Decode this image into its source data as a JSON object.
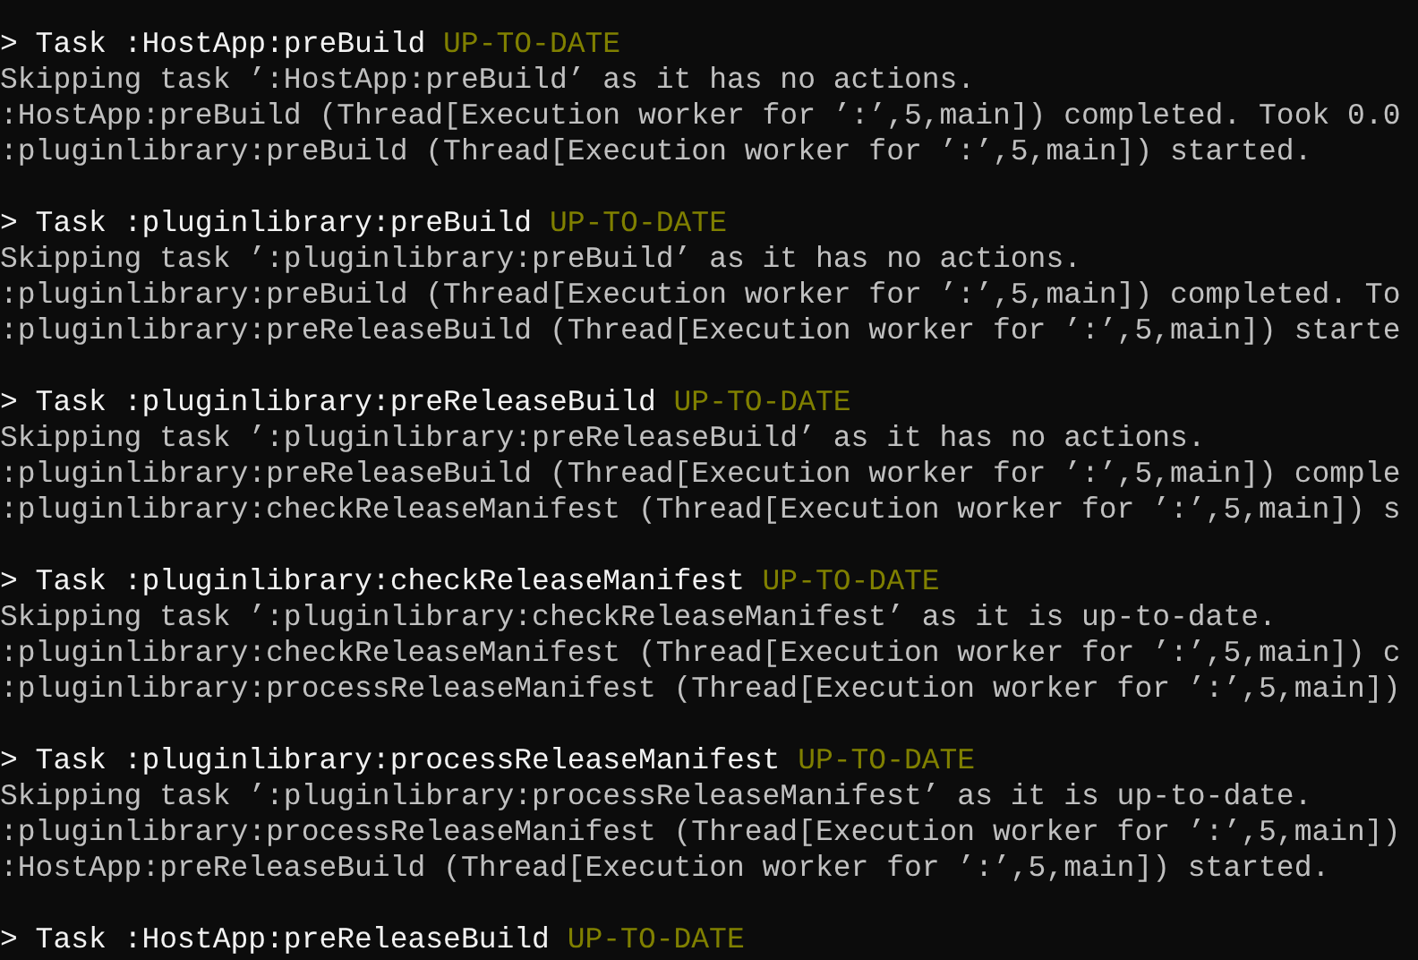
{
  "console": {
    "groups": [
      {
        "title": "> Task :HostApp:preBuild",
        "status": "UP-TO-DATE",
        "lines": [
          "Skipping task ’:HostApp:preBuild’ as it has no actions.",
          ":HostApp:preBuild (Thread[Execution worker for ’:’,5,main]) completed. Took 0.0",
          ":pluginlibrary:preBuild (Thread[Execution worker for ’:’,5,main]) started."
        ]
      },
      {
        "title": "> Task :pluginlibrary:preBuild",
        "status": "UP-TO-DATE",
        "lines": [
          "Skipping task ’:pluginlibrary:preBuild’ as it has no actions.",
          ":pluginlibrary:preBuild (Thread[Execution worker for ’:’,5,main]) completed. To",
          ":pluginlibrary:preReleaseBuild (Thread[Execution worker for ’:’,5,main]) starte"
        ]
      },
      {
        "title": "> Task :pluginlibrary:preReleaseBuild",
        "status": "UP-TO-DATE",
        "lines": [
          "Skipping task ’:pluginlibrary:preReleaseBuild’ as it has no actions.",
          ":pluginlibrary:preReleaseBuild (Thread[Execution worker for ’:’,5,main]) comple",
          ":pluginlibrary:checkReleaseManifest (Thread[Execution worker for ’:’,5,main]) s"
        ]
      },
      {
        "title": "> Task :pluginlibrary:checkReleaseManifest",
        "status": "UP-TO-DATE",
        "lines": [
          "Skipping task ’:pluginlibrary:checkReleaseManifest’ as it is up-to-date.",
          ":pluginlibrary:checkReleaseManifest (Thread[Execution worker for ’:’,5,main]) c",
          ":pluginlibrary:processReleaseManifest (Thread[Execution worker for ’:’,5,main])"
        ]
      },
      {
        "title": "> Task :pluginlibrary:processReleaseManifest",
        "status": "UP-TO-DATE",
        "lines": [
          "Skipping task ’:pluginlibrary:processReleaseManifest’ as it is up-to-date.",
          ":pluginlibrary:processReleaseManifest (Thread[Execution worker for ’:’,5,main])",
          ":HostApp:preReleaseBuild (Thread[Execution worker for ’:’,5,main]) started."
        ]
      },
      {
        "title": "> Task :HostApp:preReleaseBuild",
        "status": "UP-TO-DATE"
      }
    ]
  }
}
